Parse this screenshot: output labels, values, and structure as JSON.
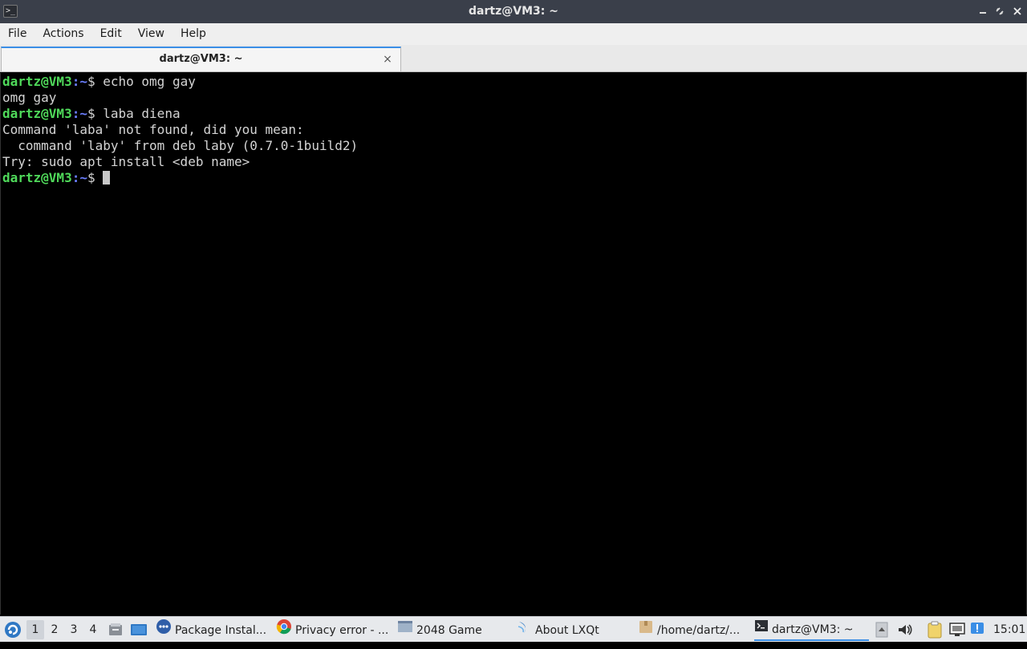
{
  "window": {
    "title": "dartz@VM3: ~",
    "app_icon_glyph": ">_",
    "minimize_icon": "minimize-icon",
    "maximize_icon": "maximize-icon",
    "close_icon": "close-icon"
  },
  "menubar": {
    "items": [
      "File",
      "Actions",
      "Edit",
      "View",
      "Help"
    ]
  },
  "tabs": [
    {
      "label": "dartz@VM3: ~",
      "close": "×"
    }
  ],
  "terminal": {
    "lines": [
      {
        "type": "prompt",
        "user": "dartz@VM3",
        "sep": ":",
        "path": "~",
        "symbol": "$ ",
        "command": "echo omg gay"
      },
      {
        "type": "output",
        "text": "omg gay"
      },
      {
        "type": "prompt",
        "user": "dartz@VM3",
        "sep": ":",
        "path": "~",
        "symbol": "$ ",
        "command": "laba diena"
      },
      {
        "type": "output",
        "text": "Command 'laba' not found, did you mean:"
      },
      {
        "type": "output",
        "text": "  command 'laby' from deb laby (0.7.0-1build2)"
      },
      {
        "type": "output",
        "text": "Try: sudo apt install <deb name>"
      },
      {
        "type": "prompt",
        "user": "dartz@VM3",
        "sep": ":",
        "path": "~",
        "symbol": "$ ",
        "command": ""
      }
    ]
  },
  "taskbar": {
    "desktops": [
      "1",
      "2",
      "3",
      "4"
    ],
    "active_desktop": "1",
    "tasks": [
      {
        "label": "Package Instal...",
        "icon": "package-installer-icon"
      },
      {
        "label": "Privacy error - ...",
        "icon": "chrome-icon"
      },
      {
        "label": "2048 Game",
        "icon": "window-icon"
      },
      {
        "label": "About LXQt",
        "icon": "lxqt-icon"
      },
      {
        "label": "/home/dartz/...",
        "icon": "folder-icon"
      },
      {
        "label": "dartz@VM3: ~",
        "icon": "terminal-icon"
      }
    ],
    "active_task": "dartz@VM3: ~",
    "clock": "15:01"
  }
}
